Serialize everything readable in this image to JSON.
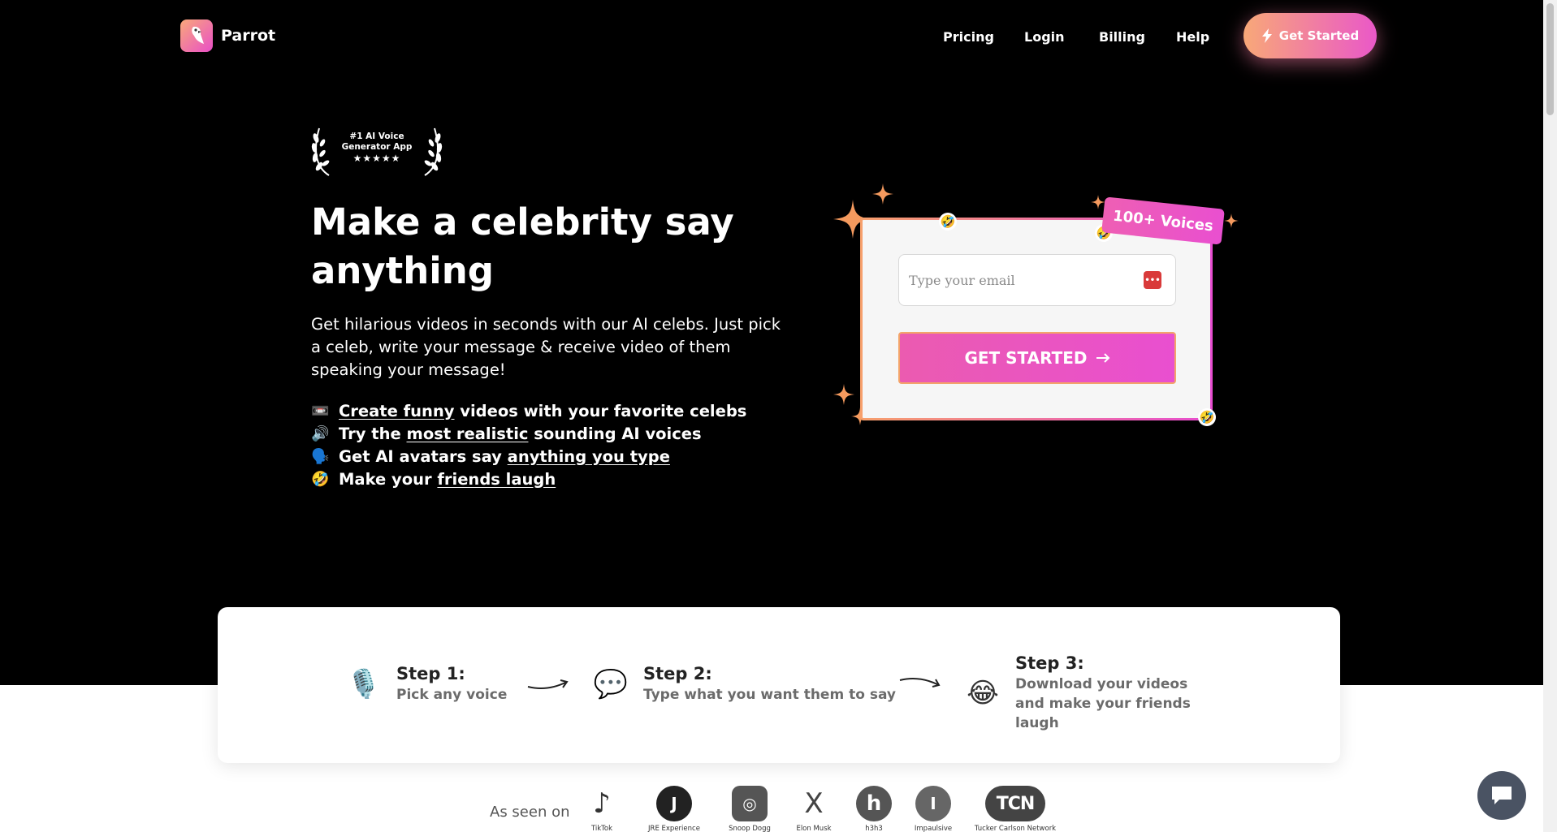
{
  "brand": {
    "name": "Parrot"
  },
  "nav": {
    "items": [
      "Pricing",
      "Login",
      "Billing",
      "Help"
    ],
    "cta_label": "Get Started"
  },
  "badge": {
    "line1": "#1 AI Voice",
    "line2": "Generator App",
    "stars": "★★★★★"
  },
  "hero": {
    "title": "Make a celebrity say anything",
    "subtitle": "Get hilarious videos in seconds with our AI celebs. Just pick a celeb, write your message & receive video of them speaking your message!",
    "features": [
      {
        "icon": "📼",
        "pre": "",
        "link": "Create funny",
        "post": " videos with your favorite celebs"
      },
      {
        "icon": "🔊",
        "pre": "Try the ",
        "link": "most realistic",
        "post": " sounding AI voices"
      },
      {
        "icon": "🗣️",
        "pre": "Get AI avatars say ",
        "link": "anything you type",
        "post": ""
      },
      {
        "icon": "🤣",
        "pre": "Make your ",
        "link": "friends laugh",
        "post": ""
      }
    ]
  },
  "signup": {
    "email_placeholder": "Type your email",
    "cta_label": "GET STARTED",
    "tag": "100+ Voices"
  },
  "steps": [
    {
      "icon": "🎙️",
      "title": "Step 1:",
      "desc": "Pick any voice"
    },
    {
      "icon": "💬",
      "title": "Step 2:",
      "desc": "Type what you want them to say"
    },
    {
      "icon": "😂",
      "title": "Step 3:",
      "desc": "Download your videos and make your friends laugh"
    }
  ],
  "seen_on": {
    "label": "As seen on",
    "logos": [
      {
        "mark": "♪",
        "name": "TikTok"
      },
      {
        "mark": "J",
        "name": "JRE Experience"
      },
      {
        "mark": "◎",
        "name": "Snoop Dogg"
      },
      {
        "mark": "X",
        "name": "Elon Musk"
      },
      {
        "mark": "h",
        "name": "h3h3"
      },
      {
        "mark": "I",
        "name": "Impaulsive"
      },
      {
        "mark": "TCN",
        "name": "Tucker Carlson Network"
      }
    ]
  },
  "colors": {
    "accent_start": "#f8a878",
    "accent_end": "#ea58c8",
    "hero_bg": "#000000"
  }
}
